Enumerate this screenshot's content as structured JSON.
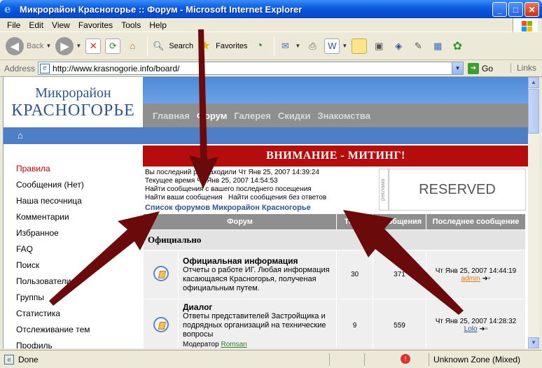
{
  "window": {
    "title": "Микрорайон Красногорье :: Форум - Microsoft Internet Explorer",
    "buttons": [
      "_",
      "□",
      "✕"
    ]
  },
  "menu": [
    "File",
    "Edit",
    "View",
    "Favorites",
    "Tools",
    "Help"
  ],
  "toolbar": {
    "back_label": "Back",
    "search_label": "Search",
    "favorites_label": "Favorites"
  },
  "address": {
    "label": "Address",
    "url": "http://www.krasnogorie.info/board/",
    "go_label": "Go",
    "links_label": "Links"
  },
  "site": {
    "logo_line1": "Микрорайон",
    "logo_line2": "КРАСНОГОРЬЕ",
    "nav": [
      {
        "label": "Главная",
        "current": false
      },
      {
        "label": "Форум",
        "current": true
      },
      {
        "label": "Галерея",
        "current": false
      },
      {
        "label": "Скидки",
        "current": false
      },
      {
        "label": "Знакомства",
        "current": false
      }
    ],
    "home_icon": "home-icon",
    "sidebar": [
      {
        "label": "Правила",
        "hot": true
      },
      {
        "label": "Сообщения (Нет)",
        "hot": false
      },
      {
        "label": "Наша песочница",
        "hot": false
      },
      {
        "label": "Комментарии",
        "hot": false
      },
      {
        "label": "Избранное",
        "hot": false
      },
      {
        "label": "FAQ",
        "hot": false
      },
      {
        "label": "Поиск",
        "hot": false
      },
      {
        "label": "Пользователи",
        "hot": false
      },
      {
        "label": "Группы",
        "hot": false
      },
      {
        "label": "Статистика",
        "hot": false
      },
      {
        "label": "Отслеживание тем",
        "hot": false
      },
      {
        "label": "Профиль",
        "hot": false
      }
    ],
    "banner": "ВНИМАНИЕ - МИТИНГ!",
    "last_visit": "Вы последний раз заходили Чт Янв 25, 2007 14:39:24",
    "current_time": "Текущее время Чт Янв 25, 2007 14:54:53",
    "new_posts_link": "Найти сообщения с вашего последнего посещения",
    "your_posts_link": "Найти ваши сообщения",
    "unanswered_link": "Найти сообщения без ответов",
    "breadcrumb": "Список форумов Микрорайон Красногорье",
    "reserved": "RESERVED",
    "reklama": "реклама",
    "table": {
      "headers": [
        "Форум",
        "Темы",
        "Сообщения",
        "Последнее сообщение"
      ],
      "category": "Официально",
      "forums": [
        {
          "name": "Официальная информация",
          "desc": "Отчеты о работе ИГ. Любая информация касающаяся Красногорья, полученая официальным путем.",
          "moderator_label": "",
          "moderator": "",
          "topics": "30",
          "posts": "371",
          "last_date": "Чт Янв 25, 2007 14:44:19",
          "last_by": "admin"
        },
        {
          "name": "Диалог",
          "desc": "Ответы представителей Застройщика и подрядных организаций на технические вопросы",
          "moderator_label": "Модератор",
          "moderator": "Romsan",
          "topics": "9",
          "posts": "559",
          "last_date": "Чт Янв 25, 2007 14:28:32",
          "last_by": "Lolo"
        }
      ]
    }
  },
  "status": {
    "text": "Done",
    "zone": "Unknown Zone (Mixed)"
  },
  "colors": {
    "arrow": "#6b0a0a",
    "banner": "#b50d0d",
    "link_blue": "#2f5592"
  }
}
